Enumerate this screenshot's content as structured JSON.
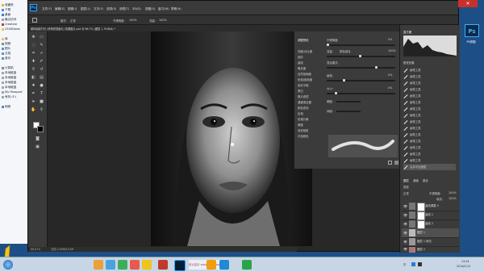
{
  "explorer": {
    "items": [
      "收藏夹",
      "下载",
      "桌面",
      "最近访问",
      "Creative",
      "2345Down",
      "库",
      "视频",
      "图片",
      "文档",
      "音乐",
      "计算机",
      "本地磁盘",
      "本地磁盘",
      "本地磁盘",
      "本地磁盘",
      "My Passport",
      "有特 (F:)",
      "网络"
    ]
  },
  "photoshop": {
    "logo": "Ps",
    "menu": [
      "文件(F)",
      "编辑(E)",
      "图像(I)",
      "图层(L)",
      "文字(Y)",
      "选择(S)",
      "滤镜(T)",
      "3D(D)",
      "视图(V)",
      "窗口(W)",
      "帮助(H)"
    ],
    "options": {
      "mode_label": "模式:",
      "mode_value": "正常",
      "opacity_label": "不透明度:",
      "opacity_value": "100%",
      "flow_label": "流量:",
      "flow_value": "100%"
    },
    "doc_tab": "模特面部打光 (修饰质感面孔) 效果图片.psd @ 66.7% (图层 1, RGB/8) *",
    "status": {
      "zoom": "66.67%",
      "doc": "文档:2.63M/8.93M"
    },
    "adjust": {
      "title": "调整预设",
      "items": [
        "亮度/对比度",
        "色阶",
        "曲线",
        "曝光度",
        "自然饱和度",
        "色相/饱和度",
        "色彩平衡",
        "黑白",
        "照片滤镜",
        "通道混合器",
        "颜色查找",
        "反相",
        "色调分离",
        "阈值",
        "渐变映射",
        "可选颜色"
      ],
      "labels": [
        "不透明度:",
        "流量:",
        "混合模式:",
        "画笔:",
        "大小:",
        "硬度:",
        "间距:"
      ],
      "values": [
        "0%",
        "100%",
        "0%",
        "0%"
      ],
      "mode_value": "颜色减淡"
    },
    "histogram_title": "直方图",
    "history": {
      "title": "历史记录",
      "items": [
        "画笔工具",
        "画笔工具",
        "画笔工具",
        "画笔工具",
        "画笔工具",
        "画笔工具",
        "画笔工具",
        "画笔工具",
        "画笔工具",
        "画笔工具",
        "画笔工具",
        "画笔工具",
        "画笔工具",
        "画笔工具",
        "画笔工具",
        "合并可见图层"
      ]
    },
    "layers": {
      "tabs": [
        "图层",
        "通道",
        "路径"
      ],
      "kind_label": "类型",
      "blend_mode": "正常",
      "opacity_label": "不透明度:",
      "opacity_value": "100%",
      "fill_label": "填充:",
      "fill_value": "100%",
      "items": [
        "曲线调整 4",
        "曲线 1",
        "曲线 2",
        "图层 1",
        "图层 1 拷贝",
        "图层 2",
        "背景 0 拷贝",
        "背景 0"
      ]
    }
  },
  "desktop": {
    "ps_icon_text": "Ps",
    "ps_icon_label": "PS修图"
  },
  "taskbar": {
    "input_label": "中",
    "clock_time": "13:41",
    "clock_date": "2016/1/12",
    "banner": "设计高手 www.shejigao.com"
  },
  "colors": {
    "ps_bg": "#282828",
    "panel": "#3b3b3b",
    "desktop": "#1d4f86",
    "accent": "#31a8ff"
  }
}
